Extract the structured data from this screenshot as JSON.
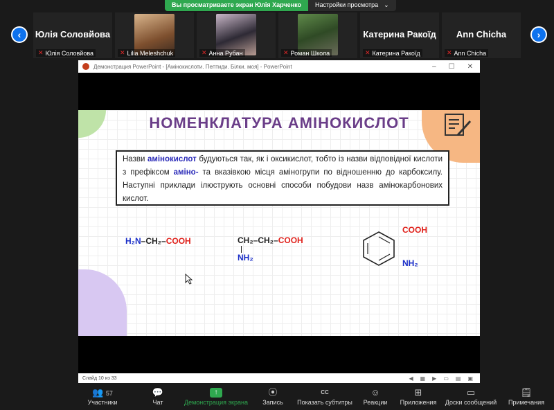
{
  "banner": {
    "viewing_text": "Вы просматриваете экран Юлія Харченко",
    "view_settings": "Настройки просмотра",
    "chevron": "⌄"
  },
  "participants": [
    {
      "big_name": "Юлія Соловйова",
      "label": "Юлія Соловйова"
    },
    {
      "label": "Lilia Meleshchuk"
    },
    {
      "label": "Анна Рубан"
    },
    {
      "label": "Роман Школа"
    },
    {
      "big_name": "Катерина Ракоїд",
      "label": "Катерина Ракоїд"
    },
    {
      "big_name": "Ann Chicha",
      "label": "Ann Chicha"
    }
  ],
  "ppt": {
    "window_title": "Демонстрация PowerPoint - [Амінокислоти. Пептиди. Білки. моя] - PowerPoint",
    "slide_title": "НОМЕНКЛАТУРА АМІНОКИСЛОТ",
    "text_part1": "Назви ",
    "text_hl1": "амінокислот",
    "text_part2": " будуються так, як і оксикислот, тобто із назви відповідної кислоти з префіксом ",
    "text_hl2": "аміно-",
    "text_part3": " та вказівкою місця аміногрупи по відношенню до карбоксилу. Наступні приклади ілюструють основні способи побудови назв амінокарбонових кислот.",
    "formula1": {
      "n": "H₂N",
      "c": "–CH₂–",
      "r": "COOH"
    },
    "formula2": {
      "c": "CH₂–CH₂–",
      "r": "COOH",
      "n": "NH₂"
    },
    "formula3": {
      "r": "COOH",
      "n": "NH₂"
    },
    "status": "Слайд 10 из 33"
  },
  "toolbar": {
    "participants": "Участники",
    "participants_count": "57",
    "chat": "Чат",
    "share": "Демонстрация экрана",
    "record": "Запись",
    "subtitles": "Показать субтитры",
    "subtitles_icon": "CC",
    "reactions": "Реакции",
    "apps": "Приложения",
    "whiteboards": "Доски сообщений",
    "notes": "Примечания"
  },
  "colors": {
    "accent_green": "#2fa84f",
    "accent_blue": "#0e72ed",
    "title_purple": "#6a3d88"
  }
}
